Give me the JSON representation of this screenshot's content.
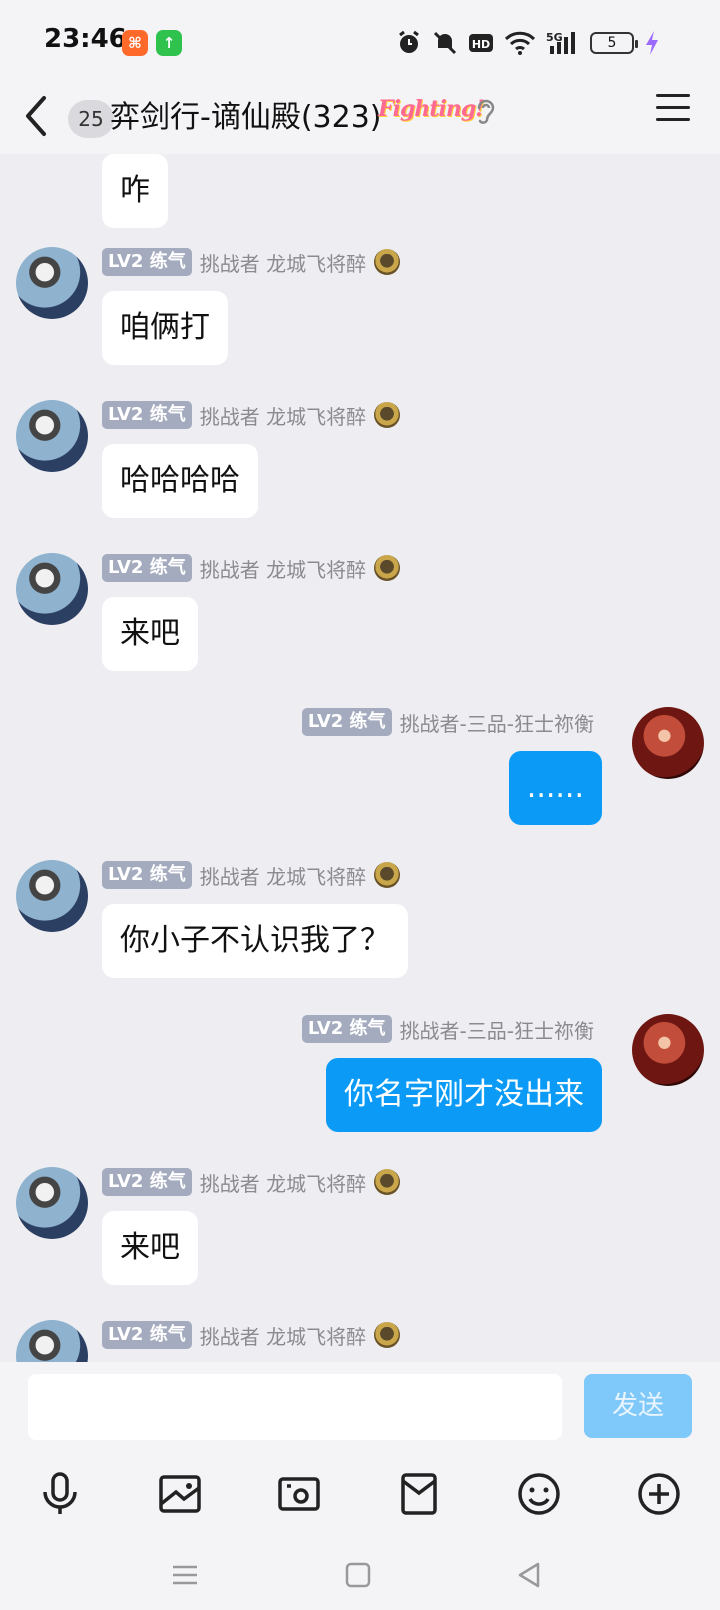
{
  "status_bar": {
    "time": "23:46",
    "battery_level": "5",
    "network": "5G",
    "icons": [
      "app-badge-orange",
      "app-badge-green",
      "alarm-icon",
      "mute-icon",
      "hd-icon",
      "wifi-icon",
      "signal-icon",
      "battery-icon",
      "charging-icon"
    ]
  },
  "header": {
    "unread_count": "25",
    "title": "弈剑行-谪仙殿(323)",
    "badge_text": "Fighting!",
    "icons": [
      "back-icon",
      "ear-icon",
      "menu-icon"
    ]
  },
  "messages": [
    {
      "side": "left",
      "badge": "",
      "name": "",
      "text": "咋",
      "partial": true
    },
    {
      "side": "left",
      "badge": "LV2 练气",
      "name": "挑战者 龙城飞将醉",
      "text": "咱俩打"
    },
    {
      "side": "left",
      "badge": "LV2 练气",
      "name": "挑战者 龙城飞将醉",
      "text": "哈哈哈哈"
    },
    {
      "side": "left",
      "badge": "LV2 练气",
      "name": "挑战者 龙城飞将醉",
      "text": "来吧"
    },
    {
      "side": "right",
      "badge": "LV2 练气",
      "name": "挑战者-三品-狂士祢衡",
      "text": "......"
    },
    {
      "side": "left",
      "badge": "LV2 练气",
      "name": "挑战者 龙城飞将醉",
      "text": "你小子不认识我了？"
    },
    {
      "side": "right",
      "badge": "LV2 练气",
      "name": "挑战者-三品-狂士祢衡",
      "text": "你名字刚才没出来"
    },
    {
      "side": "left",
      "badge": "LV2 练气",
      "name": "挑战者 龙城飞将醉",
      "text": "来吧"
    },
    {
      "side": "left",
      "badge": "LV2 练气",
      "name": "挑战者 龙城飞将醉",
      "text": "",
      "partial": true
    }
  ],
  "input": {
    "placeholder": "",
    "send_label": "发送"
  },
  "toolbar": {
    "icons": [
      "microphone-icon",
      "image-icon",
      "camera-icon",
      "red-packet-icon",
      "emoji-icon",
      "plus-icon"
    ]
  },
  "colors": {
    "background": "#eeeef2",
    "my_bubble": "#0b9bf6",
    "other_bubble": "#ffffff",
    "level_badge": "#a4abbe",
    "send_button": "#7ec8fa"
  }
}
